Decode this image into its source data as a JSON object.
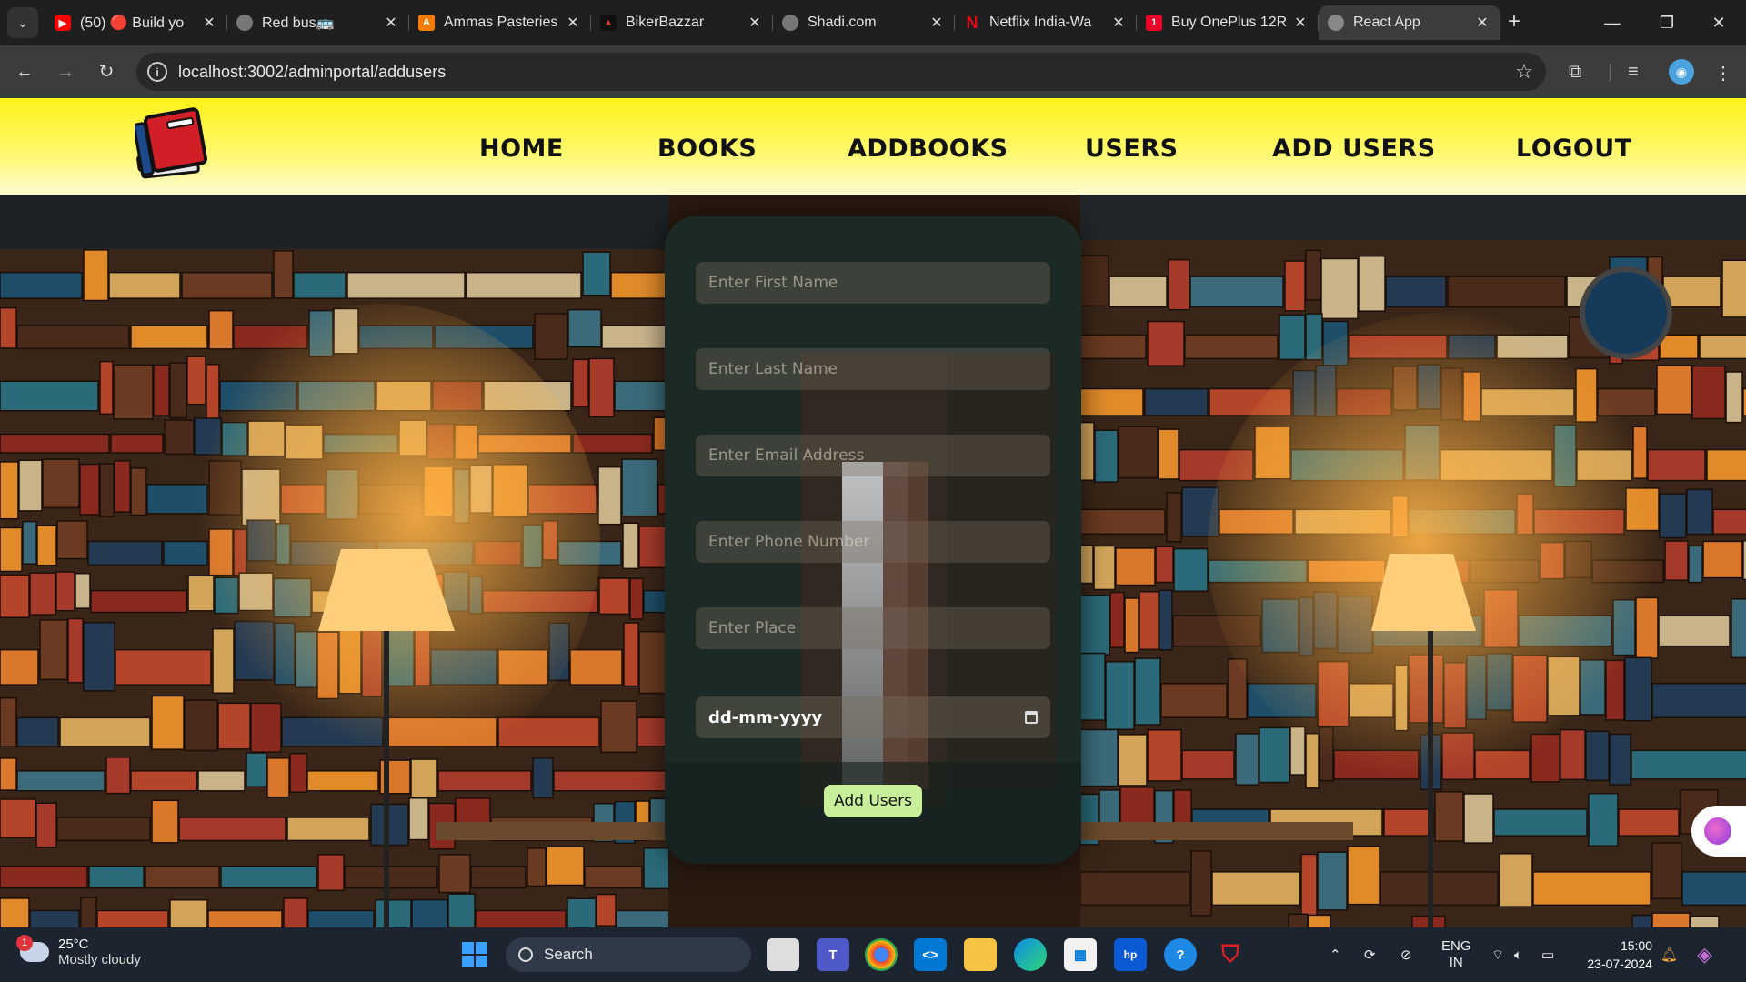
{
  "browser": {
    "tabs": [
      {
        "title": "(50) 🔴 Build yo",
        "favicon": "youtube-icon",
        "color": "#ff0000"
      },
      {
        "title": "Red bus🚌",
        "favicon": "globe-icon",
        "color": "#888888"
      },
      {
        "title": "Ammas Pasteries",
        "favicon": "ammas-icon",
        "color": "#f57c00"
      },
      {
        "title": "BikerBazzar",
        "favicon": "bikerbazzar-icon",
        "color": "#222222"
      },
      {
        "title": "Shadi.com",
        "favicon": "globe-icon",
        "color": "#888888"
      },
      {
        "title": "Netflix India-Wa",
        "favicon": "netflix-icon",
        "color": "#e50914"
      },
      {
        "title": "Buy OnePlus 12R",
        "favicon": "oneplus-icon",
        "color": "#eb0028"
      },
      {
        "title": "React App",
        "favicon": "globe-icon",
        "color": "#888888"
      }
    ],
    "new_tab": "+",
    "url": "localhost:3002/adminportal/addusers"
  },
  "site": {
    "nav": [
      "HOME",
      "BOOKS",
      "ADDBOOKS",
      "USERS",
      "ADD USERS",
      "LOGOUT"
    ]
  },
  "form": {
    "first_name_placeholder": "Enter First Name",
    "last_name_placeholder": "Enter Last Name",
    "email_placeholder": "Enter Email Address",
    "phone_placeholder": "Enter Phone Number",
    "place_placeholder": "Enter Place",
    "date_value": "dd-mm-yyyy",
    "submit_label": "Add Users"
  },
  "taskbar": {
    "temperature": "25°C",
    "weather": "Mostly cloudy",
    "weather_badge": "1",
    "search_label": "Search",
    "lang_1": "ENG",
    "lang_2": "IN",
    "time": "15:00",
    "date": "23-07-2024"
  },
  "colors": {
    "nav_bg": "#fff21a",
    "button_bg": "#c9ef9a",
    "card_bg": "#162420"
  }
}
